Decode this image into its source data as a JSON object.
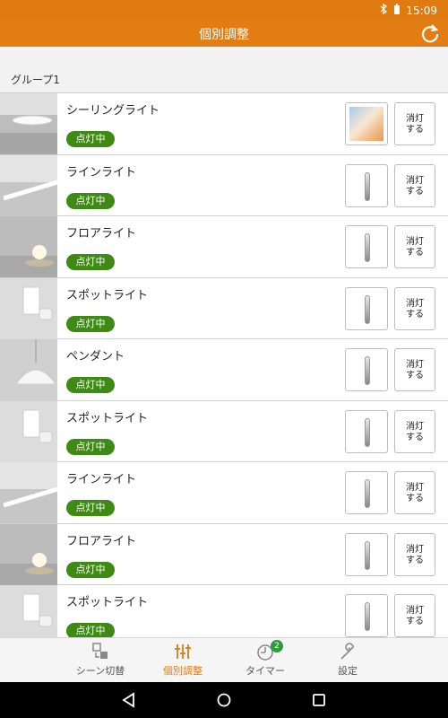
{
  "status": {
    "time": "15:09"
  },
  "header": {
    "title": "個別調整"
  },
  "group": {
    "name": "グループ1"
  },
  "items": [
    {
      "name": "シーリングライト",
      "status": "点灯中",
      "off_label_1": "消灯",
      "off_label_2": "する"
    },
    {
      "name": "ラインライト",
      "status": "点灯中",
      "off_label_1": "消灯",
      "off_label_2": "する"
    },
    {
      "name": "フロアライト",
      "status": "点灯中",
      "off_label_1": "消灯",
      "off_label_2": "する"
    },
    {
      "name": "スポットライト",
      "status": "点灯中",
      "off_label_1": "消灯",
      "off_label_2": "する"
    },
    {
      "name": "ペンダント",
      "status": "点灯中",
      "off_label_1": "消灯",
      "off_label_2": "する"
    },
    {
      "name": "スポットライト",
      "status": "点灯中",
      "off_label_1": "消灯",
      "off_label_2": "する"
    },
    {
      "name": "ラインライト",
      "status": "点灯中",
      "off_label_1": "消灯",
      "off_label_2": "する"
    },
    {
      "name": "フロアライト",
      "status": "点灯中",
      "off_label_1": "消灯",
      "off_label_2": "する"
    },
    {
      "name": "スポットライト",
      "status": "点灯中",
      "off_label_1": "消灯",
      "off_label_2": "する"
    }
  ],
  "nav": {
    "scene": "シーン切替",
    "individual": "個別調整",
    "timer": "タイマー",
    "timer_badge": "2",
    "settings": "設定"
  },
  "colors": {
    "accent": "#e07b12",
    "badge_green": "#3e8a14"
  }
}
